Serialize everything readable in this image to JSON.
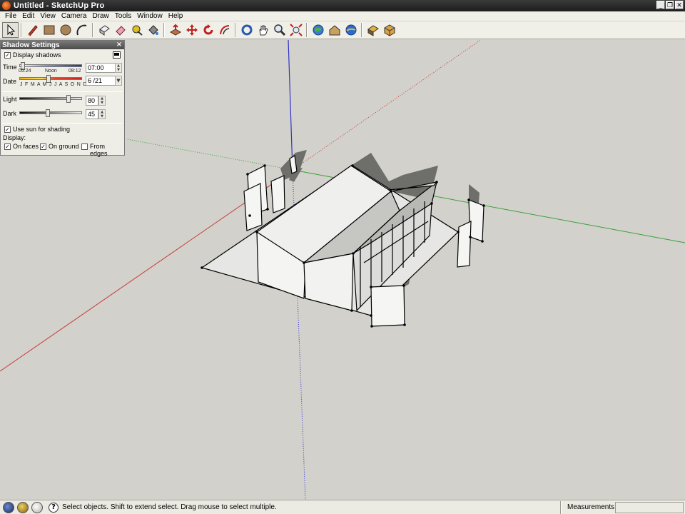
{
  "window": {
    "title": "Untitled - SketchUp Pro",
    "buttons": [
      "_",
      "❐",
      "✕"
    ]
  },
  "menubar": {
    "items": [
      "File",
      "Edit",
      "View",
      "Camera",
      "Draw",
      "Tools",
      "Window",
      "Help"
    ]
  },
  "toolbar": {
    "tools": [
      {
        "name": "select",
        "active": true
      },
      {
        "name": "line"
      },
      {
        "name": "rectangle"
      },
      {
        "name": "circle"
      },
      {
        "name": "arc"
      },
      {
        "name": "make-component"
      },
      {
        "name": "eraser"
      },
      {
        "name": "tape-measure"
      },
      {
        "name": "paint-bucket"
      },
      {
        "name": "push-pull"
      },
      {
        "name": "move"
      },
      {
        "name": "rotate"
      },
      {
        "name": "offset"
      },
      {
        "name": "orbit"
      },
      {
        "name": "pan"
      },
      {
        "name": "zoom"
      },
      {
        "name": "zoom-extents"
      },
      {
        "name": "get-models"
      },
      {
        "name": "share-model"
      },
      {
        "name": "preview-google-earth"
      },
      {
        "name": "get-photo-textures"
      },
      {
        "name": "components"
      }
    ]
  },
  "shadow_panel": {
    "title": "Shadow Settings",
    "close": "×",
    "display_shadows_label": "Display shadows",
    "display_shadows_checked": true,
    "time_label": "Time",
    "time_min": "05:24",
    "time_noon": "Noon",
    "time_max": "08:12",
    "time_value": "07:00",
    "date_label": "Date",
    "date_months": "J F M A M J J A S O N D",
    "date_value": "6 /21",
    "light_label": "Light",
    "light_value": "80",
    "dark_label": "Dark",
    "dark_value": "45",
    "use_sun_label": "Use sun for shading",
    "use_sun_checked": true,
    "display_label": "Display:",
    "on_faces_label": "On faces",
    "on_faces_checked": true,
    "on_ground_label": "On ground",
    "on_ground_checked": true,
    "from_edges_label": "From edges",
    "from_edges_checked": false,
    "time_fraction": 0.03,
    "date_fraction": 0.46,
    "light_fraction": 0.8,
    "dark_fraction": 0.45,
    "check_mark": "✓"
  },
  "statusbar": {
    "message": "Select objects. Shift to extend select. Drag mouse to select multiple.",
    "help_icon": "?",
    "measurements_label": "Measurements",
    "measurements_value": ""
  },
  "colors": {
    "red_axis": "#c83c3c",
    "green_axis": "#3ca03c",
    "blue_axis": "#3232c8",
    "viewport_bg": "#d2d1cb",
    "shadow": "#6e6e6a"
  }
}
